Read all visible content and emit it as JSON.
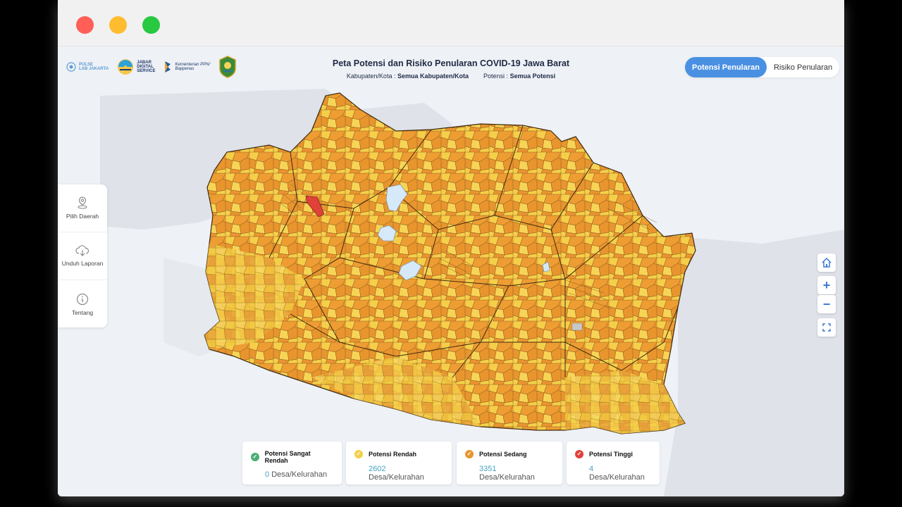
{
  "header": {
    "title": "Peta Potensi dan Risiko Penularan COVID-19 Jawa Barat",
    "filter_region_label": "Kabupaten/Kota :",
    "filter_region_value": "Semua Kabupaten/Kota",
    "filter_potensi_label": "Potensi :",
    "filter_potensi_value": "Semua Potensi",
    "logos": {
      "pulse_lab_line1": "PULSE",
      "pulse_lab_line2": "LAB JAKARTA",
      "jabar_line1": "JABAR",
      "jabar_line2": "DIGITAL",
      "jabar_line3": "SERVICE",
      "bappenas_line1": "Kementerian PPN/",
      "bappenas_line2": "Bappenas"
    }
  },
  "toggle": {
    "potensi": "Potensi Penularan",
    "risiko": "Risiko Penularan",
    "active": "potensi"
  },
  "sidebar": {
    "items": [
      {
        "label": "Pilih Daerah",
        "icon": "location-pin-icon"
      },
      {
        "label": "Unduh Laporan",
        "icon": "cloud-download-icon"
      },
      {
        "label": "Tentang",
        "icon": "info-icon"
      }
    ]
  },
  "map_controls": {
    "home_icon": "home-icon",
    "zoom_in": "+",
    "zoom_out": "−",
    "fullscreen_icon": "fullscreen-icon"
  },
  "legend": [
    {
      "label": "Potensi Sangat Rendah",
      "count": "0",
      "unit": "Desa/Kelurahan",
      "color": "#4caf73"
    },
    {
      "label": "Potensi Rendah",
      "count": "2602",
      "unit": "Desa/Kelurahan",
      "color": "#f5cf4a"
    },
    {
      "label": "Potensi Sedang",
      "count": "3351",
      "unit": "Desa/Kelurahan",
      "color": "#e8952e"
    },
    {
      "label": "Potensi Tinggi",
      "count": "4",
      "unit": "Desa/Kelurahan",
      "color": "#e0413b"
    }
  ],
  "colors": {
    "accent": "#4a90e2",
    "map_low": "#f5cf4a",
    "map_medium": "#e8952e",
    "map_high": "#e0413b",
    "water": "#d6e9f8",
    "no_data": "#c8c8c8"
  }
}
